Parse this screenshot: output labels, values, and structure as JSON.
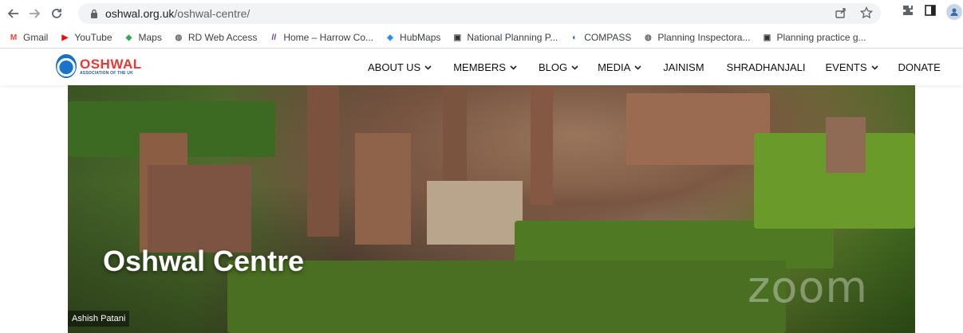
{
  "browser": {
    "url_host": "oshwal.org.uk",
    "url_path": "/oshwal-centre/"
  },
  "bookmarks": [
    {
      "label": "Gmail",
      "icon": "gmail-icon",
      "color": "#ea4335"
    },
    {
      "label": "YouTube",
      "icon": "youtube-icon",
      "color": "#ff0000"
    },
    {
      "label": "Maps",
      "icon": "maps-icon",
      "color": "#34a853"
    },
    {
      "label": "RD Web Access",
      "icon": "globe-icon",
      "color": "#5f6368"
    },
    {
      "label": "Home – Harrow Co...",
      "icon": "harrow-icon",
      "color": "#5b2d8e"
    },
    {
      "label": "HubMaps",
      "icon": "hubmaps-icon",
      "color": "#1e88e5"
    },
    {
      "label": "National Planning P...",
      "icon": "gov-icon",
      "color": "#333333"
    },
    {
      "label": "COMPASS",
      "icon": "compass-icon",
      "color": "#1565c0"
    },
    {
      "label": "Planning Inspectora...",
      "icon": "globe-icon",
      "color": "#5f6368"
    },
    {
      "label": "Planning practice g...",
      "icon": "gov-icon",
      "color": "#333333"
    }
  ],
  "site": {
    "logo_name": "OSHWAL",
    "logo_sub": "ASSOCIATION OF THE UK",
    "menu": [
      {
        "label": "ABOUT US",
        "dropdown": true
      },
      {
        "label": "MEMBERS",
        "dropdown": true
      },
      {
        "label": "BLOG",
        "dropdown": true
      },
      {
        "label": "MEDIA",
        "dropdown": true
      },
      {
        "label": "JAINISM",
        "dropdown": false
      },
      {
        "label": "SHRADHANJALI",
        "dropdown": false
      },
      {
        "label": "EVENTS",
        "dropdown": true
      },
      {
        "label": "DONATE",
        "dropdown": false
      }
    ]
  },
  "hero": {
    "title": "Oshwal Centre",
    "watermark": "zoom",
    "participant_name": "Ashish Patani"
  }
}
